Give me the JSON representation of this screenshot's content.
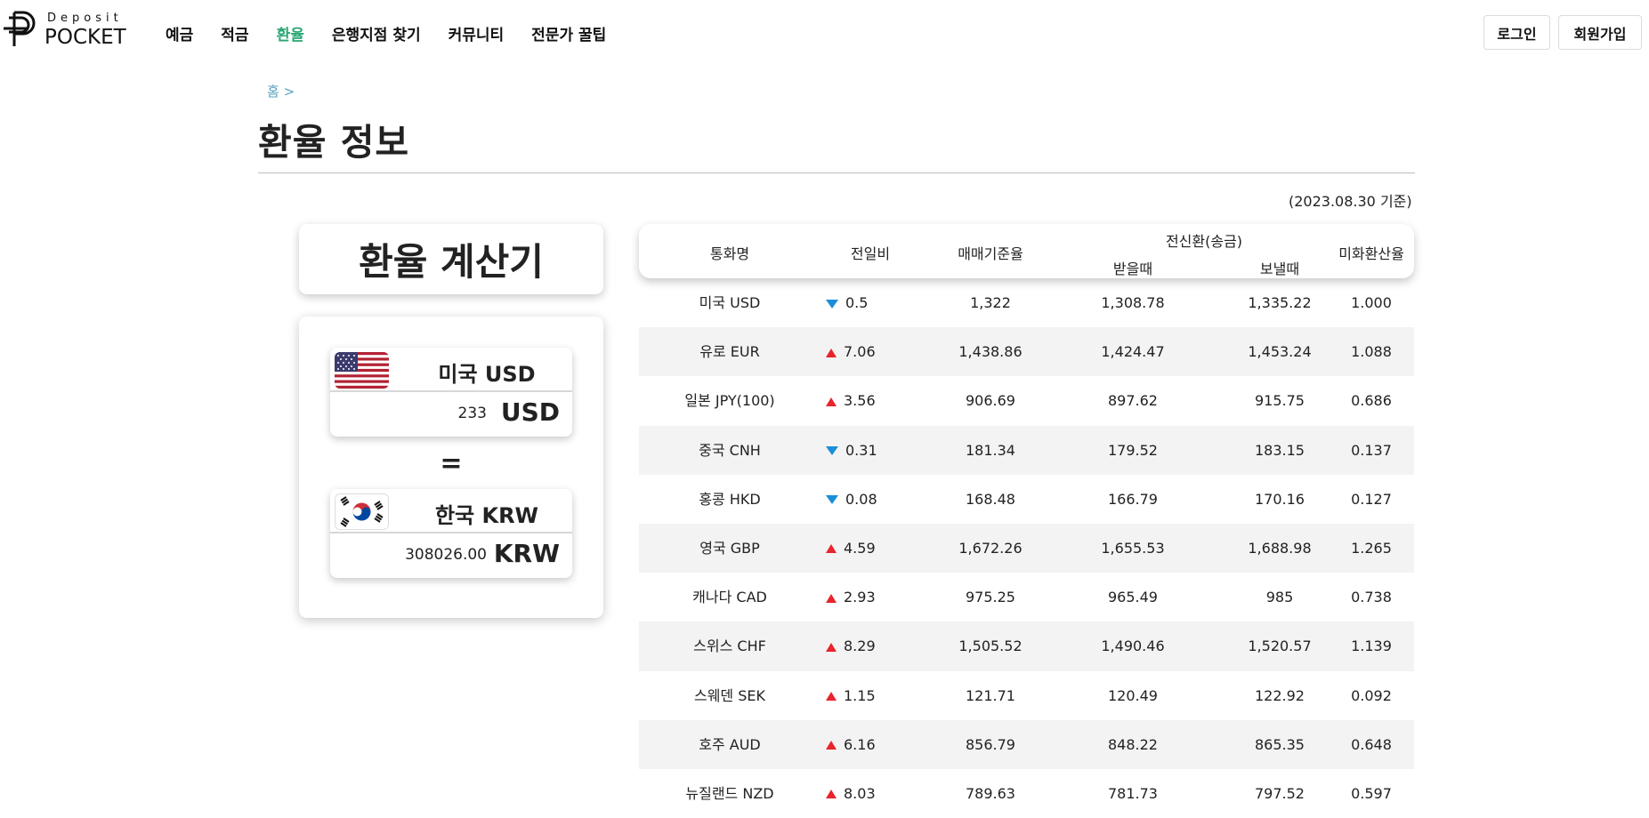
{
  "brand": {
    "small": "Deposit",
    "big": "POCKET"
  },
  "nav": [
    {
      "label": "예금"
    },
    {
      "label": "적금"
    },
    {
      "label": "환율",
      "active": true
    },
    {
      "label": "은행지점 찾기"
    },
    {
      "label": "커뮤니티"
    },
    {
      "label": "전문가 꿀팁"
    }
  ],
  "auth": {
    "login": "로그인",
    "signup": "회원가입"
  },
  "breadcrumb": "홈 >",
  "page_title": "환율 정보",
  "basis_date": "(2023.08.30 기준)",
  "calculator": {
    "title": "환율 계산기",
    "from": {
      "name": "미국 USD",
      "amount": "233",
      "unit": "USD",
      "flag": "us-flag-icon"
    },
    "equals": "=",
    "to": {
      "name": "한국 KRW",
      "amount": "308026.00",
      "unit": "KRW",
      "flag": "kr-flag-icon"
    }
  },
  "table": {
    "headers": {
      "currency": "통화명",
      "change": "전일비",
      "base_rate": "매매기준율",
      "wire_group": "전신환(송금)",
      "receive": "받을때",
      "send": "보낼때",
      "usd_rate": "미화환산율"
    },
    "rows": [
      {
        "name": "미국 USD",
        "dir": "down",
        "change": "0.5",
        "base": "1,322",
        "recv": "1,308.78",
        "send": "1,335.22",
        "usd": "1.000"
      },
      {
        "name": "유로 EUR",
        "dir": "up",
        "change": "7.06",
        "base": "1,438.86",
        "recv": "1,424.47",
        "send": "1,453.24",
        "usd": "1.088"
      },
      {
        "name": "일본 JPY(100)",
        "dir": "up",
        "change": "3.56",
        "base": "906.69",
        "recv": "897.62",
        "send": "915.75",
        "usd": "0.686"
      },
      {
        "name": "중국 CNH",
        "dir": "down",
        "change": "0.31",
        "base": "181.34",
        "recv": "179.52",
        "send": "183.15",
        "usd": "0.137"
      },
      {
        "name": "홍콩 HKD",
        "dir": "down",
        "change": "0.08",
        "base": "168.48",
        "recv": "166.79",
        "send": "170.16",
        "usd": "0.127"
      },
      {
        "name": "영국 GBP",
        "dir": "up",
        "change": "4.59",
        "base": "1,672.26",
        "recv": "1,655.53",
        "send": "1,688.98",
        "usd": "1.265"
      },
      {
        "name": "캐나다 CAD",
        "dir": "up",
        "change": "2.93",
        "base": "975.25",
        "recv": "965.49",
        "send": "985",
        "usd": "0.738"
      },
      {
        "name": "스위스 CHF",
        "dir": "up",
        "change": "8.29",
        "base": "1,505.52",
        "recv": "1,490.46",
        "send": "1,520.57",
        "usd": "1.139"
      },
      {
        "name": "스웨덴 SEK",
        "dir": "up",
        "change": "1.15",
        "base": "121.71",
        "recv": "120.49",
        "send": "122.92",
        "usd": "0.092"
      },
      {
        "name": "호주 AUD",
        "dir": "up",
        "change": "6.16",
        "base": "856.79",
        "recv": "848.22",
        "send": "865.35",
        "usd": "0.648"
      },
      {
        "name": "뉴질랜드 NZD",
        "dir": "up",
        "change": "8.03",
        "base": "789.63",
        "recv": "781.73",
        "send": "797.52",
        "usd": "0.597"
      }
    ]
  },
  "colors": {
    "accent": "#2aa773",
    "up": "#e8242c",
    "down": "#1a8ed8",
    "crumb": "#58a3c2",
    "row_alt": "#f3f3f3"
  }
}
